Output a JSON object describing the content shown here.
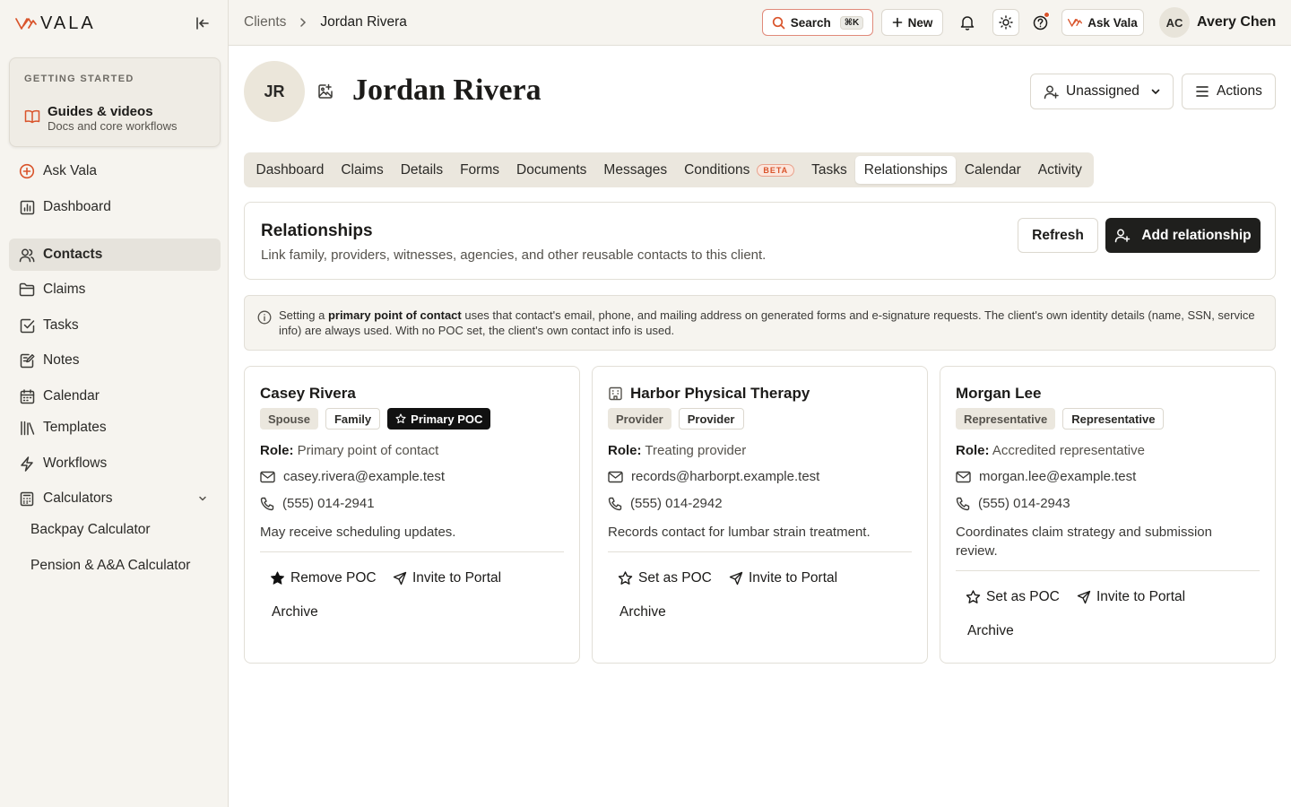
{
  "app": {
    "brand": "VALA",
    "accent_color": "#d9542b"
  },
  "sidebar": {
    "getting_started": {
      "title": "GETTING STARTED",
      "item_title": "Guides & videos",
      "item_subtitle": "Docs and core workflows"
    },
    "items": [
      {
        "label": "Ask Vala",
        "icon": "plus-circle-icon"
      },
      {
        "label": "Dashboard",
        "icon": "chart-icon"
      },
      {
        "label": "Contacts",
        "icon": "users-icon",
        "active": true
      },
      {
        "label": "Claims",
        "icon": "folder-icon"
      },
      {
        "label": "Tasks",
        "icon": "check-square-icon"
      },
      {
        "label": "Notes",
        "icon": "note-icon"
      },
      {
        "label": "Calendar",
        "icon": "calendar-icon"
      },
      {
        "label": "Templates",
        "icon": "library-icon"
      },
      {
        "label": "Workflows",
        "icon": "bolt-icon"
      },
      {
        "label": "Calculators",
        "icon": "calculator-icon"
      }
    ],
    "calculators": [
      "Backpay Calculator",
      "Pension & A&A Calculator"
    ]
  },
  "topbar": {
    "breadcrumb": {
      "parent": "Clients",
      "current": "Jordan Rivera"
    },
    "search_label": "Search",
    "search_shortcut": "⌘K",
    "new_label": "New",
    "ask_label": "Ask Vala",
    "user": {
      "initials": "AC",
      "name": "Avery Chen"
    }
  },
  "client": {
    "initials": "JR",
    "name": "Jordan Rivera",
    "assignee": "Unassigned",
    "actions_label": "Actions"
  },
  "tabs": [
    {
      "label": "Dashboard"
    },
    {
      "label": "Claims"
    },
    {
      "label": "Details"
    },
    {
      "label": "Forms"
    },
    {
      "label": "Documents"
    },
    {
      "label": "Messages"
    },
    {
      "label": "Conditions",
      "badge": "BETA"
    },
    {
      "label": "Tasks"
    },
    {
      "label": "Relationships",
      "active": true
    },
    {
      "label": "Calendar"
    },
    {
      "label": "Activity"
    }
  ],
  "relationships": {
    "title": "Relationships",
    "description": "Link family, providers, witnesses, agencies, and other reusable contacts to this client.",
    "refresh_label": "Refresh",
    "add_label": "Add relationship",
    "info": {
      "prefix": "Setting a ",
      "bold": "primary point of contact",
      "suffix": " uses that contact's email, phone, and mailing address on generated forms and e-signature requests. The client's own identity details (name, SSN, service info) are always used. With no POC set, the client's own contact info is used."
    },
    "role_label": "Role:",
    "cards": [
      {
        "name": "Casey Rivera",
        "badges": [
          "Spouse",
          "Family",
          "Primary POC"
        ],
        "role": "Primary point of contact",
        "email": "casey.rivera@example.test",
        "phone": "(555) 014-2941",
        "note": "May receive scheduling updates.",
        "poc_action": "Remove POC",
        "invite_action": "Invite to Portal",
        "archive_action": "Archive"
      },
      {
        "name": "Harbor Physical Therapy",
        "badges": [
          "Provider",
          "Provider"
        ],
        "role": "Treating provider",
        "email": "records@harborpt.example.test",
        "phone": "(555) 014-2942",
        "note": "Records contact for lumbar strain treatment.",
        "poc_action": "Set as POC",
        "invite_action": "Invite to Portal",
        "archive_action": "Archive"
      },
      {
        "name": "Morgan Lee",
        "badges": [
          "Representative",
          "Representative"
        ],
        "role": "Accredited representative",
        "email": "morgan.lee@example.test",
        "phone": "(555) 014-2943",
        "note": "Coordinates claim strategy and submission review.",
        "poc_action": "Set as POC",
        "invite_action": "Invite to Portal",
        "archive_action": "Archive"
      }
    ]
  }
}
